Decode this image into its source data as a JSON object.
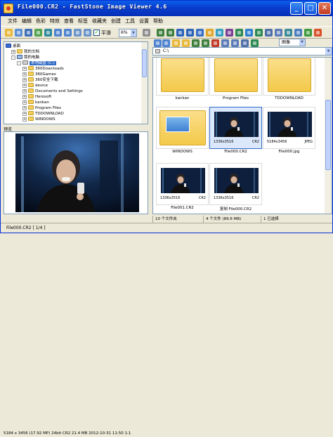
{
  "window": {
    "title": "File000.CR2 - FastStone Image Viewer 4.6"
  },
  "menu": [
    "文件",
    "编辑",
    "色彩",
    "特效",
    "查看",
    "标签",
    "收藏夹",
    "创建",
    "工具",
    "设置",
    "帮助"
  ],
  "toolbar": {
    "smooth_label": "平滑",
    "zoom_value": "6%"
  },
  "tree": {
    "items": [
      {
        "label": "桌面",
        "icon": "desktop-icon",
        "level": 0,
        "expander": ""
      },
      {
        "label": "我的文档",
        "icon": "folder-icon",
        "level": 1,
        "expander": "+"
      },
      {
        "label": "我的电脑",
        "icon": "computer-icon",
        "level": 1,
        "expander": "-"
      },
      {
        "label": "本地磁盘 (C:)",
        "icon": "drive-icon",
        "level": 2,
        "expander": "-",
        "selected": true
      },
      {
        "label": "360Downloads",
        "icon": "folder-icon",
        "level": 3,
        "expander": "+"
      },
      {
        "label": "360Games",
        "icon": "folder-icon",
        "level": 3,
        "expander": "+"
      },
      {
        "label": "360安全下载",
        "icon": "folder-icon",
        "level": 3,
        "expander": "+"
      },
      {
        "label": "device",
        "icon": "folder-icon",
        "level": 3,
        "expander": "+"
      },
      {
        "label": "Documents and Settings",
        "icon": "folder-icon",
        "level": 3,
        "expander": "+"
      },
      {
        "label": "Herosoft",
        "icon": "folder-icon",
        "level": 3,
        "expander": "+"
      },
      {
        "label": "kankan",
        "icon": "folder-icon",
        "level": 3,
        "expander": "+"
      },
      {
        "label": "Program Files",
        "icon": "folder-icon",
        "level": 3,
        "expander": "+"
      },
      {
        "label": "TDDOWNLOAD",
        "icon": "folder-icon",
        "level": 3,
        "expander": "+"
      },
      {
        "label": "WINDOWS",
        "icon": "folder-icon",
        "level": 3,
        "expander": "+"
      }
    ]
  },
  "preview": {
    "label": "预览",
    "info": "5184 x 3456 (17.92 MP)  24bit  CR2   21.4 MB   2012-10-31 11:50  1:1"
  },
  "address": {
    "path": "C:\\",
    "view_mode": "图像"
  },
  "thumbnails": [
    {
      "label": "kankan",
      "kind": "folder"
    },
    {
      "label": "Program Files",
      "kind": "folder"
    },
    {
      "label": "TDDOWNLOAD",
      "kind": "folder"
    },
    {
      "label": "WINDOWS",
      "kind": "folder-open"
    },
    {
      "label": "File000.CR2",
      "kind": "photo",
      "dim": "1336x3516",
      "fmt": "CR2",
      "selected": true
    },
    {
      "label": "File000.jpg",
      "kind": "photo",
      "dim": "5184x3456",
      "fmt": "JPEG"
    },
    {
      "label": "File001.CR2",
      "kind": "photo",
      "dim": "1336x3516",
      "fmt": "CR2"
    },
    {
      "label": "复制 File000.CR2",
      "kind": "photo",
      "dim": "1336x3516",
      "fmt": "CR2"
    }
  ],
  "status": {
    "folders": "10 个文件夹",
    "files": "4 个文件 (89.6 MB)",
    "selected": "1 已选择"
  },
  "bottom": {
    "text": "File000.CR2 [ 1/4 ]"
  },
  "colors": {
    "title_bar": "#0a3dd0",
    "selection": "#316ac5",
    "window_bg": "#ece9d8"
  }
}
